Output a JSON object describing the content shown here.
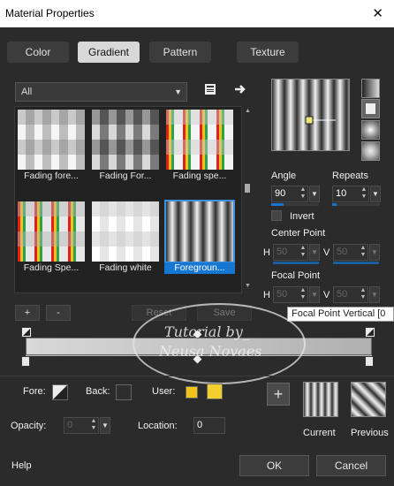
{
  "window": {
    "title": "Material Properties",
    "close_glyph": "✕"
  },
  "tabs": [
    {
      "label": "Color",
      "active": false
    },
    {
      "label": "Gradient",
      "active": true
    },
    {
      "label": "Pattern",
      "active": false
    },
    {
      "label": "Texture",
      "active": false
    }
  ],
  "category_select": {
    "value": "All"
  },
  "toolbar_icons": [
    "library-icon",
    "arrow-right-icon"
  ],
  "gradients": [
    {
      "name": "Fading fore...",
      "kind": "checker-gray"
    },
    {
      "name": "Fading For...",
      "kind": "checker-dark"
    },
    {
      "name": "Fading spe...",
      "kind": "spectrum-check"
    },
    {
      "name": "Fading Spe...",
      "kind": "spectrum-check2"
    },
    {
      "name": "Fading white",
      "kind": "white-check"
    },
    {
      "name": "Foregroun...",
      "kind": "stripes",
      "selected": true
    }
  ],
  "list_buttons": {
    "add": "+",
    "remove": "-",
    "reset": "Reset",
    "save": "Save"
  },
  "angle": {
    "label": "Angle",
    "value": "90",
    "fill": 0.25
  },
  "repeats": {
    "label": "Repeats",
    "value": "10",
    "fill": 0.1
  },
  "invert": {
    "label": "Invert",
    "checked": false
  },
  "center_point": {
    "label": "Center Point",
    "h_label": "H",
    "h_value": "50",
    "v_label": "V",
    "v_value": "50"
  },
  "focal_point": {
    "label": "Focal Point",
    "h_label": "H",
    "h_value": "50",
    "v_label": "V",
    "v_value": "50"
  },
  "tooltip": "Focal Point Vertical [0",
  "watermark": {
    "line1": "Tutorial by_",
    "line2": "Neusa Novaes"
  },
  "fore": {
    "label": "Fore:"
  },
  "back": {
    "label": "Back:"
  },
  "user": {
    "label": "User:",
    "colors": [
      "#f0c418",
      "#f3cf2e"
    ]
  },
  "opacity": {
    "label": "Opacity:",
    "value": "0"
  },
  "location": {
    "label": "Location:",
    "value": "0"
  },
  "preview_labels": {
    "current": "Current",
    "previous": "Previous"
  },
  "footer": {
    "help": "Help",
    "ok": "OK",
    "cancel": "Cancel"
  },
  "colors": {
    "accent": "#1677d2",
    "background": "#2b2b2b"
  }
}
